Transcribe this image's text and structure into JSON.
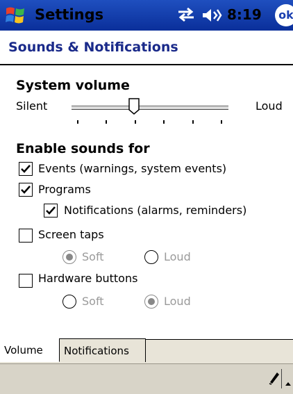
{
  "titlebar": {
    "title": "Settings",
    "clock": "8:19",
    "ok_label": "ok"
  },
  "page": {
    "title": "Sounds & Notifications"
  },
  "volume": {
    "label": "System volume",
    "min_label": "Silent",
    "max_label": "Loud",
    "level": 0.4
  },
  "enable_sounds": {
    "label": "Enable sounds for",
    "events": {
      "label": "Events (warnings, system events)",
      "checked": true
    },
    "programs": {
      "label": "Programs",
      "checked": true
    },
    "notifications": {
      "label": "Notifications (alarms, reminders)",
      "checked": true
    },
    "screen_taps": {
      "label": "Screen taps",
      "checked": false,
      "soft_label": "Soft",
      "loud_label": "Loud",
      "selected": "Soft"
    },
    "hardware_buttons": {
      "label": "Hardware buttons",
      "checked": false,
      "soft_label": "Soft",
      "loud_label": "Loud",
      "selected": "Loud"
    }
  },
  "tabs": [
    {
      "label": "Volume",
      "active": true
    },
    {
      "label": "Notifications",
      "active": false
    }
  ],
  "colors": {
    "titlebar": "#0a2f9a",
    "page_title": "#1a2a8a",
    "disabled_text": "#9a9a9a"
  }
}
